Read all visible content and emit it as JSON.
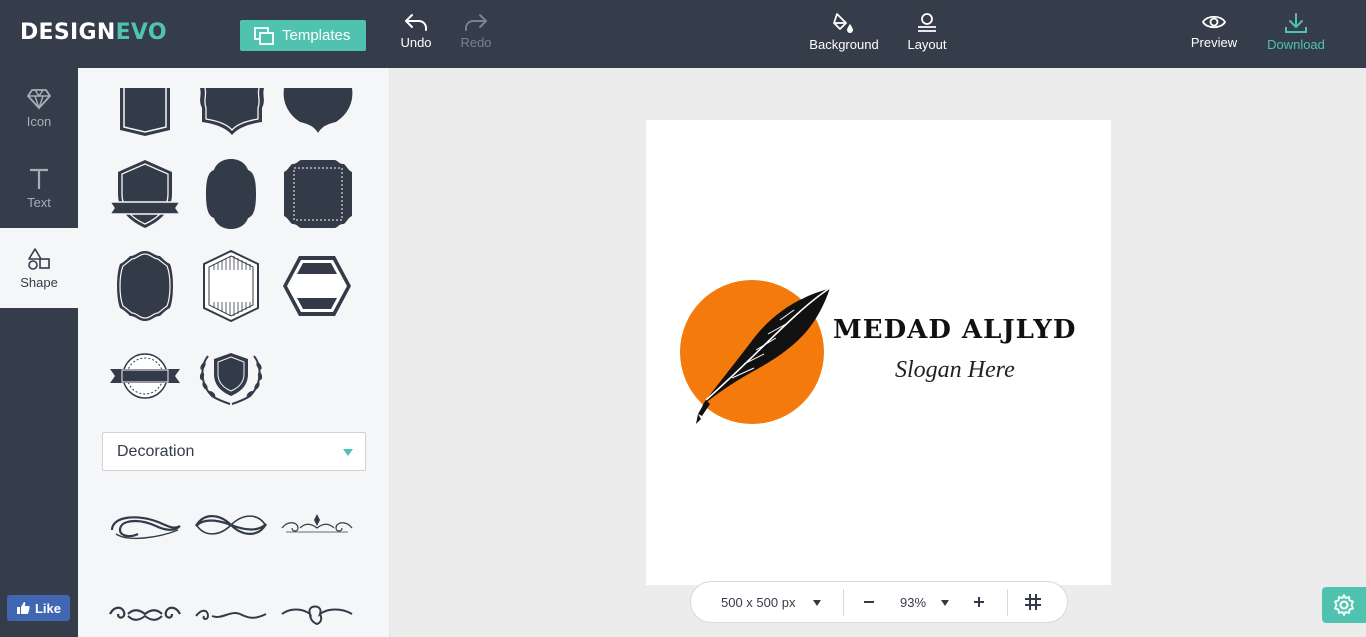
{
  "app": {
    "logo_part1": "DESIGN",
    "logo_part2": "EVO"
  },
  "toolbar": {
    "templates_label": "Templates",
    "undo_label": "Undo",
    "redo_label": "Redo",
    "background_label": "Background",
    "layout_label": "Layout",
    "preview_label": "Preview",
    "download_label": "Download"
  },
  "rail": {
    "items": [
      {
        "label": "Icon",
        "icon": "diamond-icon"
      },
      {
        "label": "Text",
        "icon": "text-t-icon"
      },
      {
        "label": "Shape",
        "icon": "shapes-icon",
        "active": true
      }
    ],
    "like_label": "Like"
  },
  "panel": {
    "category_dropdown": "Decoration"
  },
  "canvas": {
    "logo_title": "MEDAD ALJLYD",
    "logo_slogan": "Slogan Here",
    "colors": {
      "sun": "#f47a0b",
      "feather": "#111111"
    }
  },
  "controls": {
    "size_label": "500 x 500 px",
    "zoom_label": "93%"
  },
  "colors": {
    "topbar": "#353c4a",
    "accent": "#4fc3b0",
    "panel": "#f5f6f7",
    "shape": "#343b48"
  }
}
